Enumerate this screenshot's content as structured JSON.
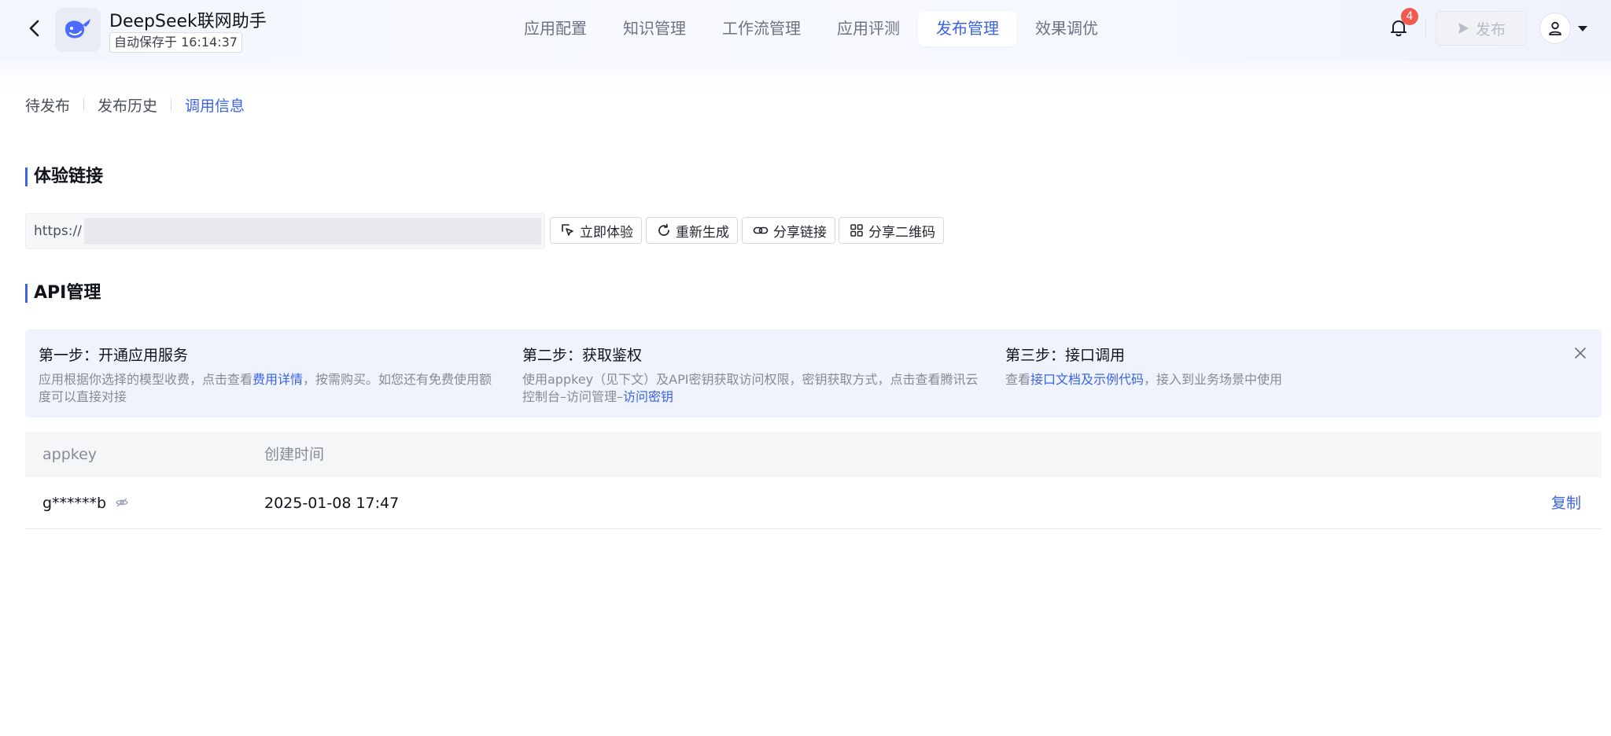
{
  "header": {
    "app_title": "DeepSeek联网助手",
    "autosave": "自动保存于 16:14:37",
    "tabs": [
      {
        "label": "应用配置"
      },
      {
        "label": "知识管理"
      },
      {
        "label": "工作流管理"
      },
      {
        "label": "应用评测"
      },
      {
        "label": "发布管理"
      },
      {
        "label": "效果调优"
      }
    ],
    "active_tab": "发布管理",
    "notification_count": "4",
    "publish_label": "发布"
  },
  "sub_tabs": [
    {
      "label": "待发布"
    },
    {
      "label": "发布历史"
    },
    {
      "label": "调用信息"
    }
  ],
  "active_sub_tab": "调用信息",
  "experience": {
    "title": "体验链接",
    "url_prefix": "https://",
    "buttons": {
      "try_now": "立即体验",
      "regenerate": "重新生成",
      "share_link": "分享链接",
      "share_qr": "分享二维码"
    }
  },
  "api": {
    "title": "API管理",
    "steps": [
      {
        "title": "第一步：开通应用服务",
        "desc_before": "应用根据你选择的模型收费，点击查看",
        "link": "费用详情",
        "desc_after": "，按需购买。如您还有免费使用额度可以直接对接"
      },
      {
        "title": "第二步：获取鉴权",
        "desc_before": "使用appkey（见下文）及API密钥获取访问权限，密钥获取方式，点击查看腾讯云控制台–访问管理–",
        "link": "访问密钥",
        "desc_after": ""
      },
      {
        "title": "第三步：接口调用",
        "desc_before": "查看",
        "link": "接口文档及示例代码",
        "desc_after": "，接入到业务场景中使用"
      }
    ],
    "table": {
      "columns": [
        "appkey",
        "创建时间"
      ],
      "rows": [
        {
          "appkey": "g******b",
          "created": "2025-01-08 17:47",
          "action": "复制"
        }
      ]
    }
  },
  "colors": {
    "accent": "#3b63e6",
    "badge": "#f05a4f",
    "panel": "#eef3fd"
  }
}
